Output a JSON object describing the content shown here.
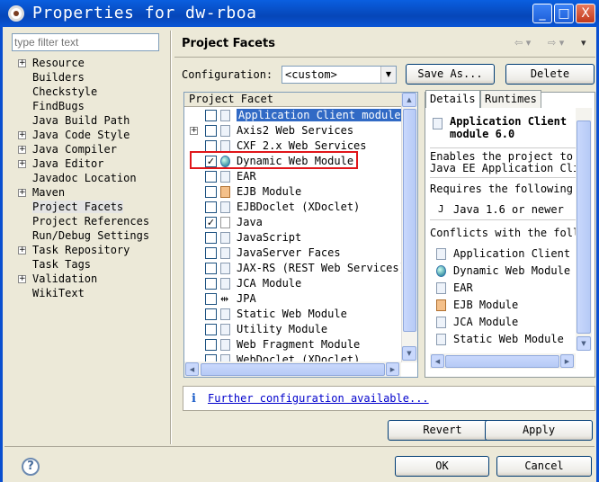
{
  "window": {
    "title": "Properties for dw-rboa",
    "min_label": "_",
    "max_label": "□",
    "close_label": "X"
  },
  "filter": {
    "placeholder": "type filter text"
  },
  "nav": {
    "items": [
      {
        "label": "Resource",
        "expandable": true
      },
      {
        "label": "Builders",
        "expandable": false
      },
      {
        "label": "Checkstyle",
        "expandable": false
      },
      {
        "label": "FindBugs",
        "expandable": false
      },
      {
        "label": "Java Build Path",
        "expandable": false
      },
      {
        "label": "Java Code Style",
        "expandable": true
      },
      {
        "label": "Java Compiler",
        "expandable": true
      },
      {
        "label": "Java Editor",
        "expandable": true
      },
      {
        "label": "Javadoc Location",
        "expandable": false
      },
      {
        "label": "Maven",
        "expandable": true
      },
      {
        "label": "Project Facets",
        "expandable": false,
        "selected": true
      },
      {
        "label": "Project References",
        "expandable": false
      },
      {
        "label": "Run/Debug Settings",
        "expandable": false
      },
      {
        "label": "Task Repository",
        "expandable": true
      },
      {
        "label": "Task Tags",
        "expandable": false
      },
      {
        "label": "Validation",
        "expandable": true
      },
      {
        "label": "WikiText",
        "expandable": false
      }
    ]
  },
  "page": {
    "title": "Project Facets",
    "back_icon": "back-arrow-icon",
    "forward_icon": "forward-arrow-icon",
    "menu_icon": "view-menu-icon"
  },
  "config": {
    "label": "Configuration:",
    "value": "<custom>",
    "save_as": "Save As...",
    "delete": "Delete"
  },
  "facets": {
    "header": "Project Facet",
    "rows": [
      {
        "label": "Application Client module",
        "checked": false,
        "icon": "doc",
        "selected": true,
        "expand": false
      },
      {
        "label": "Axis2 Web Services",
        "checked": false,
        "icon": "doc",
        "expand": true
      },
      {
        "label": "CXF 2.x Web Services",
        "checked": false,
        "icon": "doc",
        "expand": false
      },
      {
        "label": "Dynamic Web Module",
        "checked": true,
        "icon": "globe",
        "expand": false
      },
      {
        "label": "EAR",
        "checked": false,
        "icon": "doc",
        "expand": false
      },
      {
        "label": "EJB Module",
        "checked": false,
        "icon": "bean",
        "expand": false
      },
      {
        "label": "EJBDoclet (XDoclet)",
        "checked": false,
        "icon": "doc",
        "expand": false
      },
      {
        "label": "Java",
        "checked": true,
        "icon": "java",
        "expand": false
      },
      {
        "label": "JavaScript",
        "checked": false,
        "icon": "doc",
        "expand": false
      },
      {
        "label": "JavaServer Faces",
        "checked": false,
        "icon": "doc",
        "expand": false
      },
      {
        "label": "JAX-RS (REST Web Services)",
        "checked": false,
        "icon": "doc",
        "expand": false
      },
      {
        "label": "JCA Module",
        "checked": false,
        "icon": "doc",
        "expand": false
      },
      {
        "label": "JPA",
        "checked": false,
        "icon": "arrows",
        "expand": false
      },
      {
        "label": "Static Web Module",
        "checked": false,
        "icon": "doc",
        "expand": false
      },
      {
        "label": "Utility Module",
        "checked": false,
        "icon": "doc",
        "expand": false
      },
      {
        "label": "Web Fragment Module",
        "checked": false,
        "icon": "doc",
        "expand": false
      },
      {
        "label": "WebDoclet (XDoclet)",
        "checked": false,
        "icon": "doc",
        "expand": false
      }
    ]
  },
  "details": {
    "tabs": [
      "Details",
      "Runtimes"
    ],
    "title_line1": "Application Client",
    "title_line2": "module 6.0",
    "desc_line1": "Enables the project to",
    "desc_line2": "Java EE Application Cli",
    "requires": "Requires the following",
    "requires_item": "Java 1.6 or newer",
    "conflicts": "Conflicts with the foll",
    "conflict_items": [
      {
        "label": "Application Client m",
        "icon": "doc"
      },
      {
        "label": "Dynamic Web Module",
        "icon": "globe"
      },
      {
        "label": "EAR",
        "icon": "doc"
      },
      {
        "label": "EJB Module",
        "icon": "bean"
      },
      {
        "label": "JCA Module",
        "icon": "doc"
      },
      {
        "label": "Static Web Module",
        "icon": "doc"
      }
    ]
  },
  "info": {
    "icon": "i",
    "link": "Further configuration available..."
  },
  "buttons": {
    "revert": "Revert",
    "apply": "Apply",
    "ok": "OK",
    "cancel": "Cancel",
    "help": "?"
  },
  "colors": {
    "titlebar": "#0a55d6",
    "selection": "#316ac5",
    "highlight_box": "#e0161a",
    "link": "#0000cc"
  }
}
